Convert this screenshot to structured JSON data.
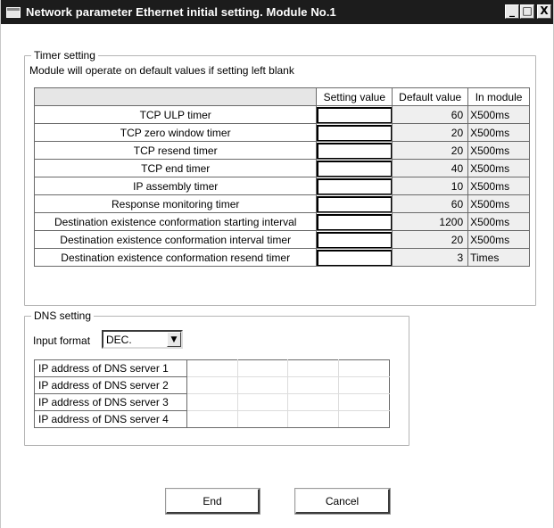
{
  "window": {
    "title": "Network parameter Ethernet initial setting. Module No.1",
    "minimize_glyph": "_",
    "maximize_glyph": "□",
    "close_glyph": "X"
  },
  "timer": {
    "group_title": "Timer setting",
    "note": "Module will operate on default values if setting left blank",
    "columns": {
      "setting": "Setting value",
      "default": "Default value",
      "unit": "In module"
    },
    "rows": [
      {
        "name": "TCP ULP timer",
        "setting": "",
        "default": "60",
        "unit": "X500ms"
      },
      {
        "name": "TCP zero window timer",
        "setting": "",
        "default": "20",
        "unit": "X500ms"
      },
      {
        "name": "TCP resend timer",
        "setting": "",
        "default": "20",
        "unit": "X500ms"
      },
      {
        "name": "TCP end timer",
        "setting": "",
        "default": "40",
        "unit": "X500ms"
      },
      {
        "name": "IP assembly timer",
        "setting": "",
        "default": "10",
        "unit": "X500ms"
      },
      {
        "name": "Response monitoring timer",
        "setting": "",
        "default": "60",
        "unit": "X500ms"
      },
      {
        "name": "Destination existence conformation starting interval",
        "setting": "",
        "default": "1200",
        "unit": "X500ms"
      },
      {
        "name": "Destination existence conformation interval timer",
        "setting": "",
        "default": "20",
        "unit": "X500ms"
      },
      {
        "name": "Destination existence conformation resend timer",
        "setting": "",
        "default": "3",
        "unit": "Times"
      }
    ]
  },
  "dns": {
    "group_title": "DNS setting",
    "input_format_label": "Input format",
    "input_format_value": "DEC.",
    "servers": [
      {
        "label": "IP address of DNS server 1",
        "octets": [
          "",
          "",
          "",
          ""
        ]
      },
      {
        "label": "IP address of DNS server 2",
        "octets": [
          "",
          "",
          "",
          ""
        ]
      },
      {
        "label": "IP address of DNS server 3",
        "octets": [
          "",
          "",
          "",
          ""
        ]
      },
      {
        "label": "IP address of DNS server 4",
        "octets": [
          "",
          "",
          "",
          ""
        ]
      }
    ]
  },
  "buttons": {
    "end": "End",
    "cancel": "Cancel"
  },
  "icons": {
    "window": "window-icon",
    "dropdown": "chevron-down-icon"
  }
}
